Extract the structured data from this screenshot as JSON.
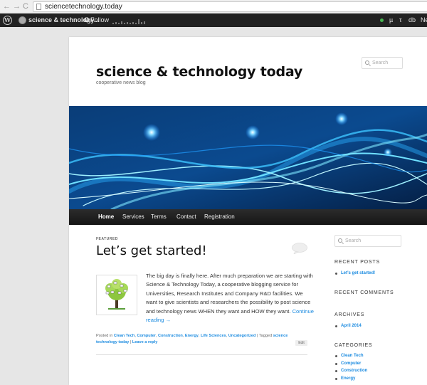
{
  "browser": {
    "back": "←",
    "forward": "→",
    "reload": "C",
    "url": "sciencetechnology.today"
  },
  "adminbar": {
    "site_name": "science & technology...",
    "follow_label": "Follow",
    "follow_glyph": "✪",
    "right_items": [
      "µ",
      "τ",
      "db",
      "Ne"
    ]
  },
  "header": {
    "title": "science & technology today",
    "tagline": "cooperative news blog",
    "search_placeholder": "Search"
  },
  "menu": {
    "items": [
      "Home",
      "Services",
      "Terms",
      "Contact",
      "Registration"
    ]
  },
  "post": {
    "kicker": "FEATURED",
    "title": "Let’s get started!",
    "body": "The big day is finally here. After much preparation we are starting with Science & Technology Today, a cooperative blogging service for Universities, Research Institutes and Company R&D facilities. We want to give scientists and researchers the possibility to post science and technology news WHEN they want and HOW they want.",
    "continue": "Continue reading →",
    "meta_posted_in": "Posted in",
    "categories": [
      "Clean Tech",
      "Computer",
      "Construction",
      "Energy",
      "Life Sciences",
      "Uncategorized"
    ],
    "meta_tagged": "| Tagged",
    "tags": [
      "science",
      "technology today"
    ],
    "leave_reply": "Leave a reply",
    "edit": "Edit"
  },
  "sidebar": {
    "search_placeholder": "Search",
    "recent_posts_title": "RECENT POSTS",
    "recent_posts": [
      "Let’s get started!"
    ],
    "recent_comments_title": "RECENT COMMENTS",
    "archives_title": "ARCHIVES",
    "archives": [
      "April 2014"
    ],
    "categories_title": "CATEGORIES",
    "categories": [
      "Clean Tech",
      "Computer",
      "Construction",
      "Energy"
    ]
  },
  "colors": {
    "link": "#1b8be0",
    "adminbar": "#222222",
    "menu": "#1e1e1e"
  }
}
